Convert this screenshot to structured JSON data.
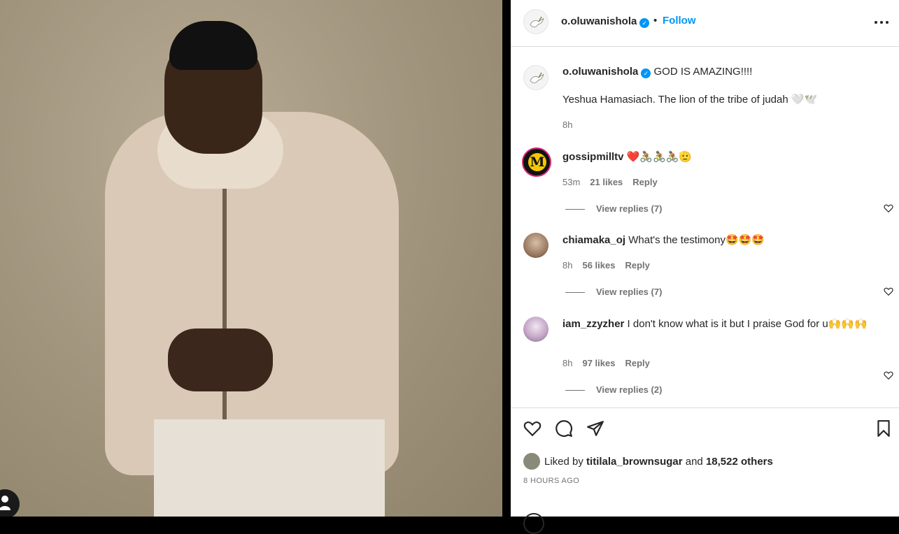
{
  "post": {
    "author": "o.oluwanishola",
    "follow_label": "Follow",
    "separator": "•",
    "caption_title": "GOD IS AMAZING!!!!",
    "caption_body": "Yeshua Hamasiach. The lion of the tribe of judah",
    "caption_emoji": "🤍🕊️",
    "caption_time": "8h",
    "verified_glyph": "✓"
  },
  "comments": [
    {
      "username": "gossipmilltv",
      "text": "",
      "emoji": "❤️🚴🏾🚴🏾🚴🏾🫡",
      "time": "53m",
      "likes": "21 likes",
      "reply_label": "Reply",
      "view_replies": "View replies (7)",
      "avatar_letter": "M"
    },
    {
      "username": "chiamaka_oj",
      "text": "What's the testimony",
      "emoji": "🤩🤩🤩",
      "time": "8h",
      "likes": "56 likes",
      "reply_label": "Reply",
      "view_replies": "View replies (7)"
    },
    {
      "username": "iam_zzyzher",
      "text": "I don't know what is it but I praise God for u",
      "emoji": "🙌🙌🙌",
      "time": "8h",
      "likes": "97 likes",
      "reply_label": "Reply",
      "view_replies": "View replies (2)"
    }
  ],
  "footer": {
    "liked_prefix": "Liked by",
    "liked_user": "titilala_brownsugar",
    "liked_and": "and",
    "liked_others": "18,522 others",
    "time_ago": "8 HOURS AGO"
  },
  "icons": {
    "like": "heart-icon",
    "comment": "comment-icon",
    "share": "share-icon",
    "save": "bookmark-icon",
    "more": "more-options-icon",
    "verified": "verified-badge-icon"
  },
  "colors": {
    "link_blue": "#0095f6",
    "text": "#262626",
    "muted": "#737373",
    "divider": "#dbdbdb"
  }
}
